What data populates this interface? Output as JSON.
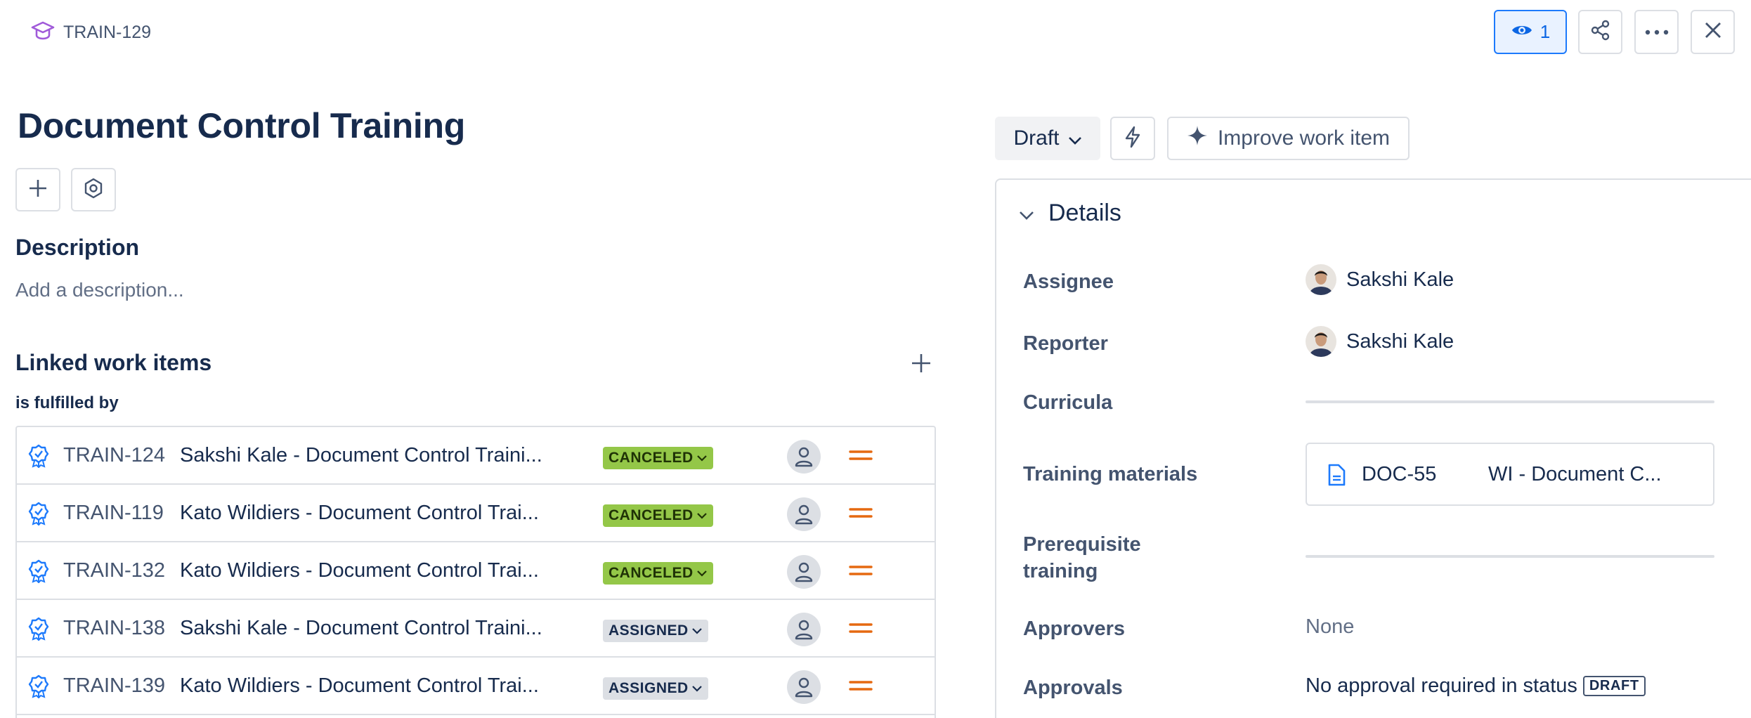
{
  "header": {
    "issue_key": "TRAIN-129",
    "watch_count": "1",
    "icons": [
      "training-icon",
      "eye-icon",
      "share-icon",
      "more-icon",
      "close-icon"
    ]
  },
  "main": {
    "title": "Document Control Training",
    "description_heading": "Description",
    "description_placeholder": "Add a description...",
    "linked_heading": "Linked work items",
    "link_type": "is fulfilled by",
    "linked_items": [
      {
        "key": "TRAIN-124",
        "summary": "Sakshi Kale - Document Control Traini...",
        "status": "CANCELED"
      },
      {
        "key": "TRAIN-119",
        "summary": "Kato Wildiers - Document Control Trai...",
        "status": "CANCELED"
      },
      {
        "key": "TRAIN-132",
        "summary": "Kato Wildiers - Document Control Trai...",
        "status": "CANCELED"
      },
      {
        "key": "TRAIN-138",
        "summary": "Sakshi Kale - Document Control Traini...",
        "status": "ASSIGNED"
      },
      {
        "key": "TRAIN-139",
        "summary": "Kato Wildiers - Document Control Trai...",
        "status": "ASSIGNED"
      }
    ]
  },
  "side": {
    "status": "Draft",
    "improve_label": "Improve work item",
    "details_title": "Details",
    "fields": {
      "assignee_label": "Assignee",
      "assignee_value": "Sakshi Kale",
      "reporter_label": "Reporter",
      "reporter_value": "Sakshi Kale",
      "curricula_label": "Curricula",
      "materials_label": "Training materials",
      "material_key": "DOC-55",
      "material_name": "WI - Document C...",
      "prereq_label_1": "Prerequisite",
      "prereq_label_2": "training",
      "approvers_label": "Approvers",
      "approvers_value": "None",
      "approvals_label": "Approvals",
      "approvals_value": "No approval required in status",
      "approvals_status": "DRAFT"
    }
  },
  "colors": {
    "brand_blue": "#0c66e4",
    "canceled_green": "#94c748",
    "assigned_gray": "#dcdfe4",
    "priority_orange": "#e56910"
  }
}
